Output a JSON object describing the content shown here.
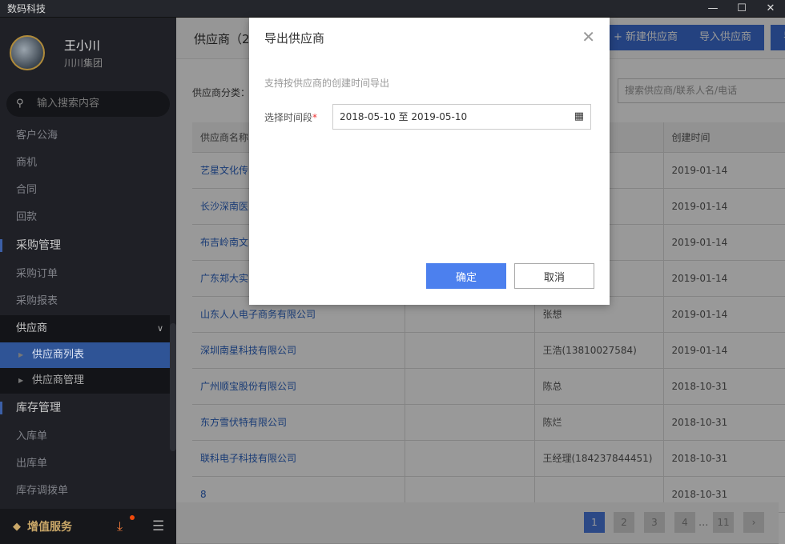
{
  "app": {
    "title": "数码科技",
    "win": [
      "—",
      "☐",
      "✕"
    ]
  },
  "user": {
    "name": "王小川",
    "company": "川川集团"
  },
  "search": {
    "placeholder": "输入搜索内容"
  },
  "nav": [
    {
      "label": "客户公海",
      "type": "item"
    },
    {
      "label": "商机",
      "type": "item"
    },
    {
      "label": "合同",
      "type": "item"
    },
    {
      "label": "回款",
      "type": "item"
    },
    {
      "label": "采购管理",
      "type": "sec"
    },
    {
      "label": "采购订单",
      "type": "item"
    },
    {
      "label": "采购报表",
      "type": "item"
    },
    {
      "label": "供应商",
      "type": "open"
    },
    {
      "label": "供应商列表",
      "type": "sub active"
    },
    {
      "label": "供应商管理",
      "type": "sub"
    },
    {
      "label": "库存管理",
      "type": "sec"
    },
    {
      "label": "入库单",
      "type": "item"
    },
    {
      "label": "出库单",
      "type": "item"
    },
    {
      "label": "库存调拨单",
      "type": "item"
    }
  ],
  "bottom": {
    "vip": "增值服务"
  },
  "main": {
    "title": "供应商（24",
    "buttons": [
      "+ 新建供应商",
      "导入供应商",
      "导"
    ],
    "filter_label": "供应商分类：",
    "search_placeholder": "搜索供应商/联系人名/电话"
  },
  "table": {
    "headers": [
      "供应商名称",
      "",
      "",
      "创建时间"
    ],
    "rows": [
      [
        "艺星文化传",
        "",
        "",
        "2019-01-14"
      ],
      [
        "长沙深南医",
        "",
        "",
        "2019-01-14"
      ],
      [
        "布吉岭南文",
        "",
        "",
        "2019-01-14"
      ],
      [
        "广东郑大实",
        "",
        "",
        "2019-01-14"
      ],
      [
        "山东人人电子商务有限公司",
        "",
        "张想",
        "2019-01-14"
      ],
      [
        "深圳南星科技有限公司",
        "",
        "王浩(13810027584)",
        "2019-01-14"
      ],
      [
        "广州顺宝股份有限公司",
        "",
        "陈总",
        "2018-10-31"
      ],
      [
        "东方雪伏特有限公司",
        "",
        "陈烂",
        "2018-10-31"
      ],
      [
        "联科电子科技有限公司",
        "",
        "王经理(184237844451)",
        "2018-10-31"
      ],
      [
        "8",
        "",
        "",
        "2018-10-31"
      ]
    ]
  },
  "pager": {
    "pages": [
      "1",
      "2",
      "3",
      "4",
      "11"
    ],
    "ellipsis": "...",
    "next": "›",
    "current": "1"
  },
  "modal": {
    "title": "导出供应商",
    "desc": "支持按供应商的创建时间导出",
    "label": "选择时间段",
    "required": "*",
    "date_range": "2018-05-10 至 2019-05-10",
    "ok": "确定",
    "cancel": "取消"
  }
}
